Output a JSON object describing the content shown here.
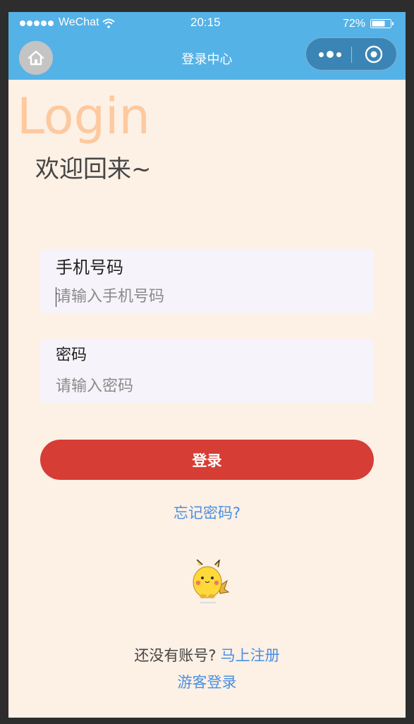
{
  "status_bar": {
    "carrier": "WeChat",
    "time": "20:15",
    "battery": "72%",
    "battery_level": 0.72
  },
  "nav": {
    "title": "登录中心"
  },
  "page": {
    "heading": "Login",
    "welcome": "欢迎回来~"
  },
  "form": {
    "phone_label": "手机号码",
    "phone_placeholder": "请输入手机号码",
    "phone_value": "",
    "password_label": "密码",
    "password_placeholder": "请输入密码",
    "password_value": "",
    "login_button": "登录"
  },
  "links": {
    "forgot": "忘记密码?",
    "no_account": "还没有账号?",
    "register": "马上注册",
    "guest": "游客登录"
  },
  "colors": {
    "header_bg": "#55b2e6",
    "page_bg": "#fdf0e5",
    "accent_red": "#d63d34",
    "link_blue": "#4a90e2",
    "login_heading": "#fdc99e"
  }
}
